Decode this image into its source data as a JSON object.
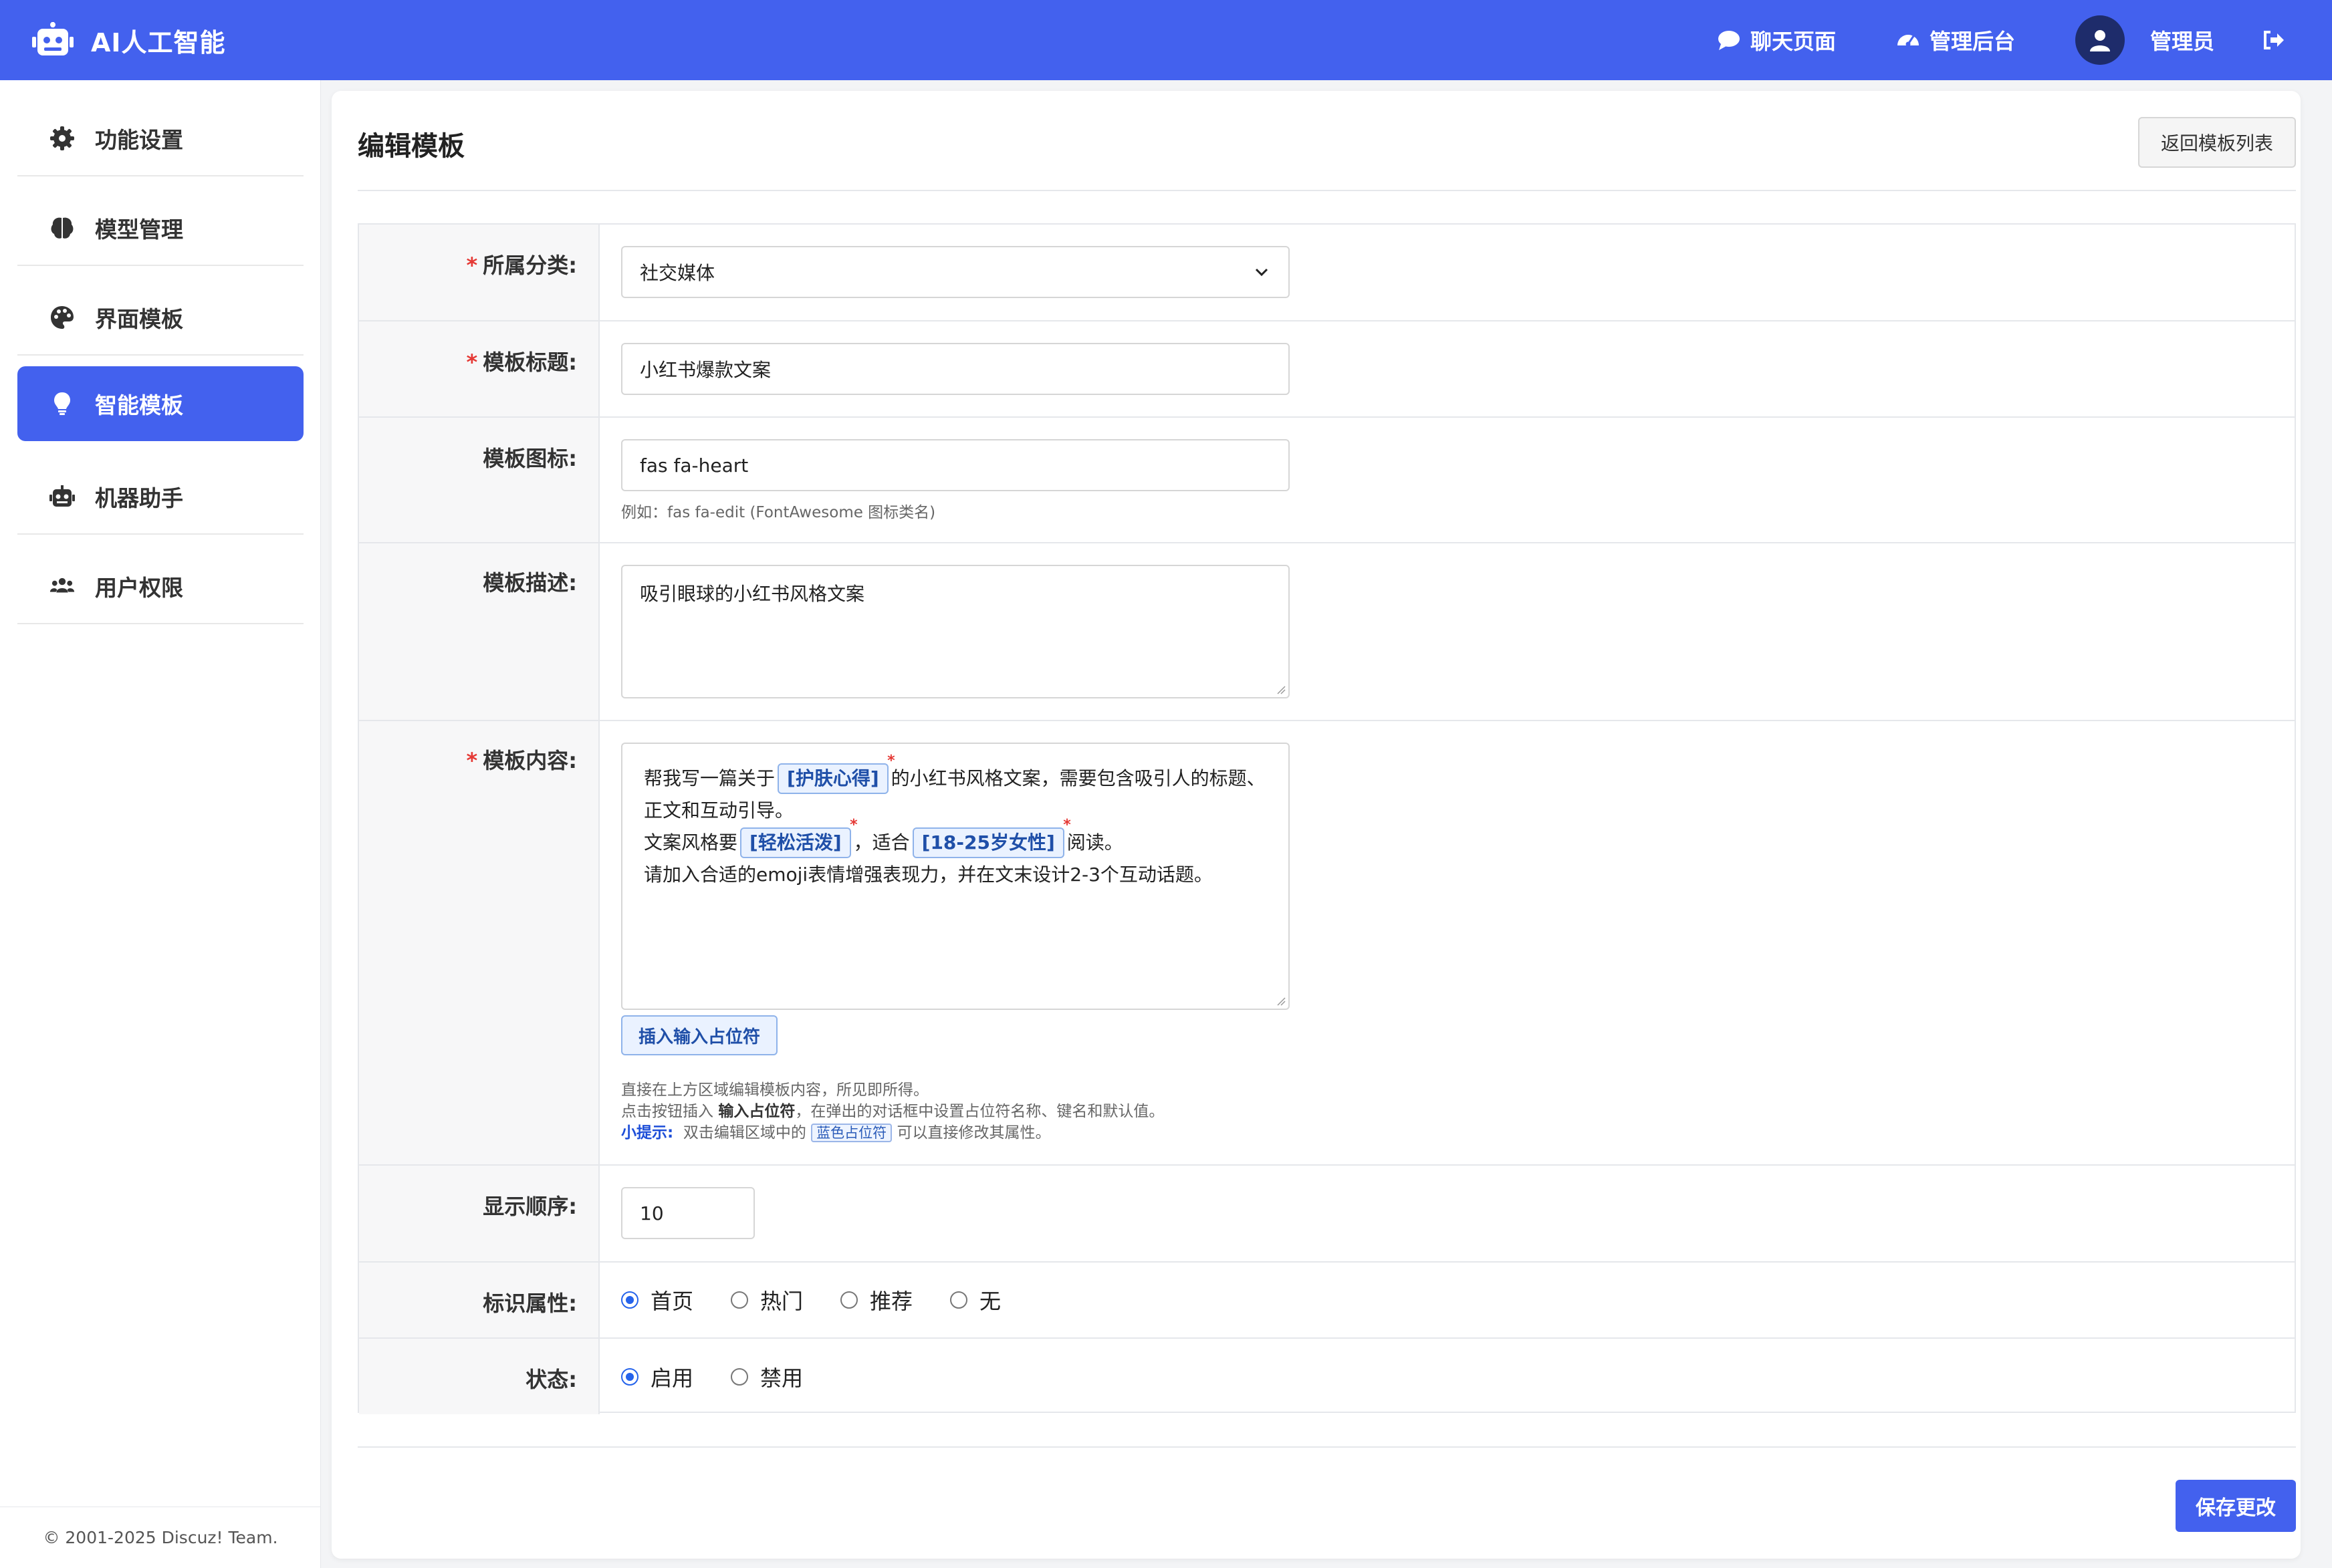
{
  "header": {
    "brand_title": "AI人工智能",
    "nav_chat": "聊天页面",
    "nav_admin": "管理后台",
    "user_name": "管理员",
    "brand_color": "#4361ee"
  },
  "sidebar": {
    "items": [
      {
        "label": "功能设置",
        "icon": "gear-icon"
      },
      {
        "label": "模型管理",
        "icon": "brain-icon"
      },
      {
        "label": "界面模板",
        "icon": "palette-icon"
      },
      {
        "label": "智能模板",
        "icon": "lightbulb-icon",
        "active": true
      },
      {
        "label": "机器助手",
        "icon": "robot-icon"
      },
      {
        "label": "用户权限",
        "icon": "users-icon"
      }
    ],
    "footer": "© 2001-2025 Discuz! Team."
  },
  "page": {
    "title": "编辑模板",
    "back_button": "返回模板列表",
    "save_button": "保存更改"
  },
  "form": {
    "category": {
      "label": "所属分类:",
      "value": "社交媒体"
    },
    "title": {
      "label": "模板标题:",
      "value": "小红书爆款文案"
    },
    "icon": {
      "label": "模板图标:",
      "value": "fas fa-heart",
      "help": "例如：fas fa-edit (FontAwesome 图标类名)"
    },
    "description": {
      "label": "模板描述:",
      "value": "吸引眼球的小红书风格文案"
    },
    "content": {
      "label": "模板内容:",
      "line1_a": "帮我写一篇关于",
      "placeholder1": "[护肤心得]",
      "line1_b": "的小红书风格文案，需要包含吸引人的标题、",
      "line2": "正文和互动引导。",
      "line3_a": "文案风格要",
      "placeholder2": "[轻松活泼]",
      "line3_b": "，适合",
      "placeholder3": "[18-25岁女性]",
      "line3_c": "阅读。",
      "line4": "请加入合适的emoji表情增强表现力，并在文末设计2-3个互动话题。",
      "insert_button": "插入输入占位符",
      "help1": "直接在上方区域编辑模板内容，所见即所得。",
      "help2_a": "点击按钮插入 ",
      "help2_b": "输入占位符",
      "help2_c": "，在弹出的对话框中设置占位符名称、键名和默认值。",
      "tip_label": "小提示:",
      "tip_a": "  双击编辑区域中的 ",
      "tip_chip": "蓝色占位符",
      "tip_b": " 可以直接修改其属性。"
    },
    "order": {
      "label": "显示顺序:",
      "value": "10"
    },
    "flags": {
      "label": "标识属性:",
      "options": [
        "首页",
        "热门",
        "推荐",
        "无"
      ],
      "selected": "首页"
    },
    "status": {
      "label": "状态:",
      "options": [
        "启用",
        "禁用"
      ],
      "selected": "启用"
    }
  }
}
